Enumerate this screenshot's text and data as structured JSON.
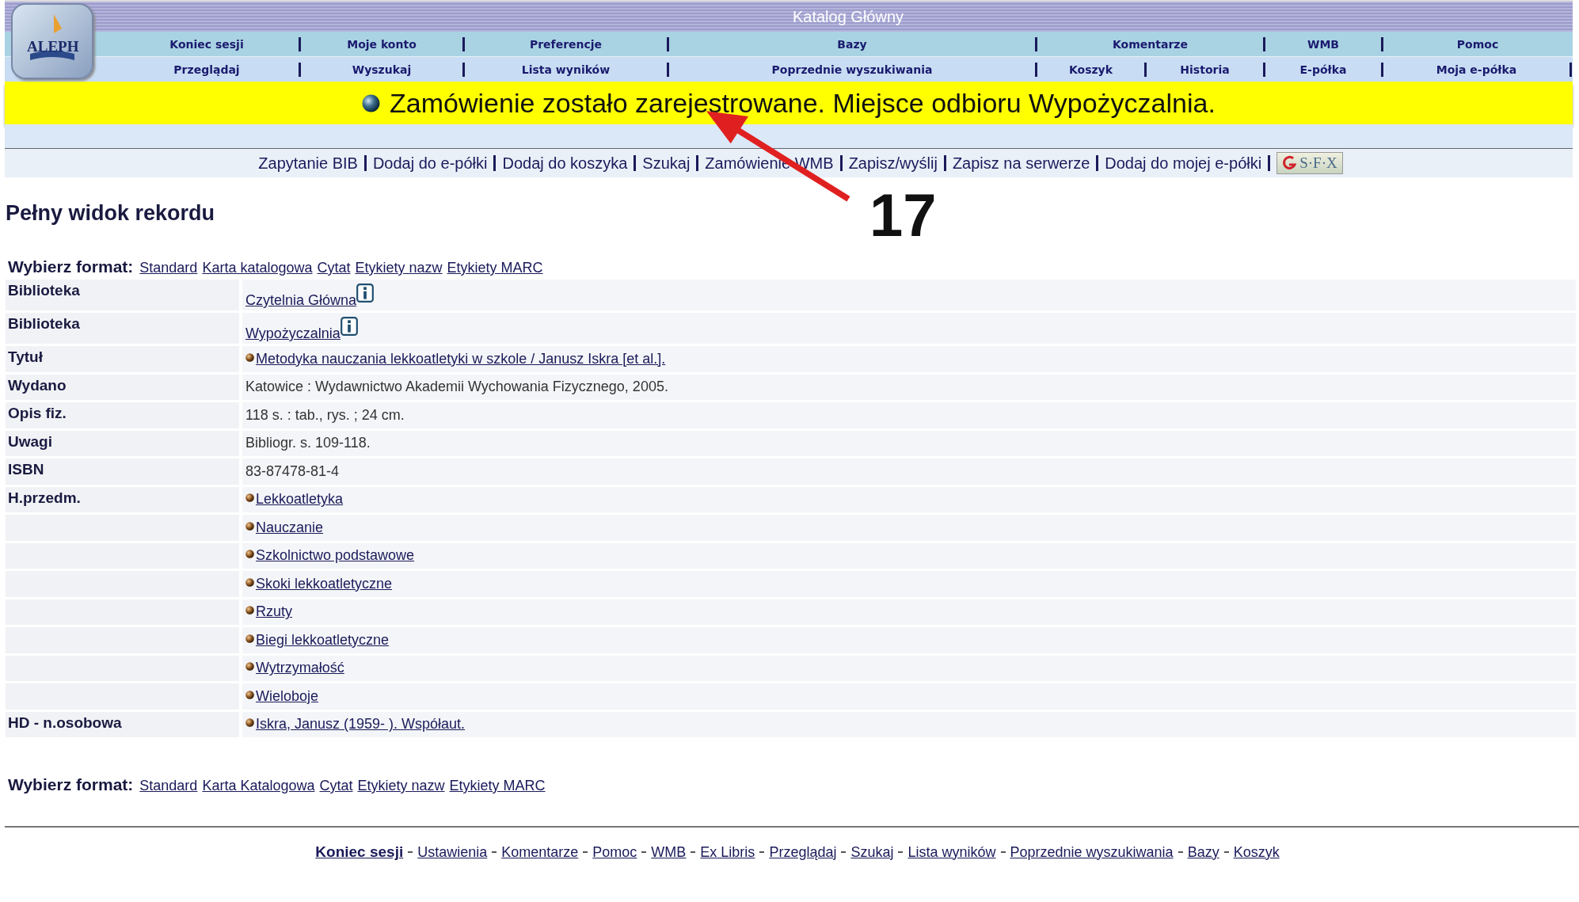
{
  "logo": "ALEPH",
  "window": {
    "title": "Katalog Główny"
  },
  "nav_rows": [
    [
      "Koniec sesji",
      "Moje konto",
      "Preferencje",
      "Bazy",
      "Komentarze",
      "WMB",
      "Pomoc"
    ],
    [
      "Przeglądaj",
      "Wyszukaj",
      "Lista wyników",
      "Poprzednie wyszukiwania",
      "Koszyk",
      "Historia",
      "E-półka",
      "Moja e-półka"
    ]
  ],
  "banner": "Zamówienie zostało zarejestrowane. Miejsce odbioru Wypożyczalnia.",
  "actions": [
    "Zapytanie BIB",
    "Dodaj do e-półki",
    "Dodaj do koszyka",
    "Szukaj",
    "Zamówienie WMB",
    "Zapisz/wyślij",
    "Zapisz na serwerze",
    "Dodaj do mojej e-półki"
  ],
  "sfx_label": "S·F·X",
  "annotation": {
    "number": "17"
  },
  "heading": "Pełny widok rekordu",
  "format_top": {
    "label": "Wybierz format:",
    "links": [
      "Standard",
      "Karta katalogowa",
      "Cytat",
      "Etykiety nazw",
      "Etykiety MARC"
    ]
  },
  "record": [
    {
      "label": "Biblioteka",
      "value": "Czytelnia Główna",
      "kind": "library"
    },
    {
      "label": "Biblioteka",
      "value": "Wypożyczalnia",
      "kind": "library"
    },
    {
      "label": "Tytuł",
      "value": "Metodyka nauczania lekkoatletyki w szkole / Janusz Iskra [et al.].",
      "kind": "link"
    },
    {
      "label": "Wydano",
      "value": "Katowice : Wydawnictwo Akademii Wychowania Fizycznego, 2005.",
      "kind": "text"
    },
    {
      "label": "Opis fiz.",
      "value": "118 s. : tab., rys. ; 24 cm.",
      "kind": "text"
    },
    {
      "label": "Uwagi",
      "value": "Bibliogr. s. 109-118.",
      "kind": "text"
    },
    {
      "label": "ISBN",
      "value": "83-87478-81-4",
      "kind": "text"
    },
    {
      "label": "H.przedm.",
      "value": "Lekkoatletyka",
      "kind": "link"
    },
    {
      "value": "Nauczanie",
      "kind": "link"
    },
    {
      "value": "Szkolnictwo podstawowe",
      "kind": "link"
    },
    {
      "value": "Skoki lekkoatletyczne",
      "kind": "link"
    },
    {
      "value": "Rzuty",
      "kind": "link"
    },
    {
      "value": "Biegi lekkoatletyczne",
      "kind": "link"
    },
    {
      "value": "Wytrzymałość",
      "kind": "link"
    },
    {
      "value": "Wieloboje",
      "kind": "link"
    },
    {
      "label": "HD - n.osobowa",
      "value": "Iskra, Janusz (1959- ). Współaut.",
      "kind": "link"
    }
  ],
  "format_bottom": {
    "label": "Wybierz format:",
    "links": [
      "Standard",
      "Karta Katalogowa",
      "Cytat",
      "Etykiety nazw",
      "Etykiety MARC"
    ]
  },
  "footer": [
    {
      "text": "Koniec sesji",
      "bold": true
    },
    {
      "text": "Ustawienia",
      "bold": false
    },
    {
      "text": "Komentarze",
      "bold": false
    },
    {
      "text": "Pomoc",
      "bold": false
    },
    {
      "text": "WMB",
      "bold": false
    },
    {
      "text": "Ex Libris",
      "bold": false
    },
    {
      "text": "Przeglądaj",
      "bold": false
    },
    {
      "text": "Szukaj",
      "bold": false
    },
    {
      "text": "Lista wyników",
      "bold": false
    },
    {
      "text": "Poprzednie wyszukiwania",
      "bold": false
    },
    {
      "text": "Bazy",
      "bold": false
    },
    {
      "text": "Koszyk",
      "bold": false
    }
  ]
}
